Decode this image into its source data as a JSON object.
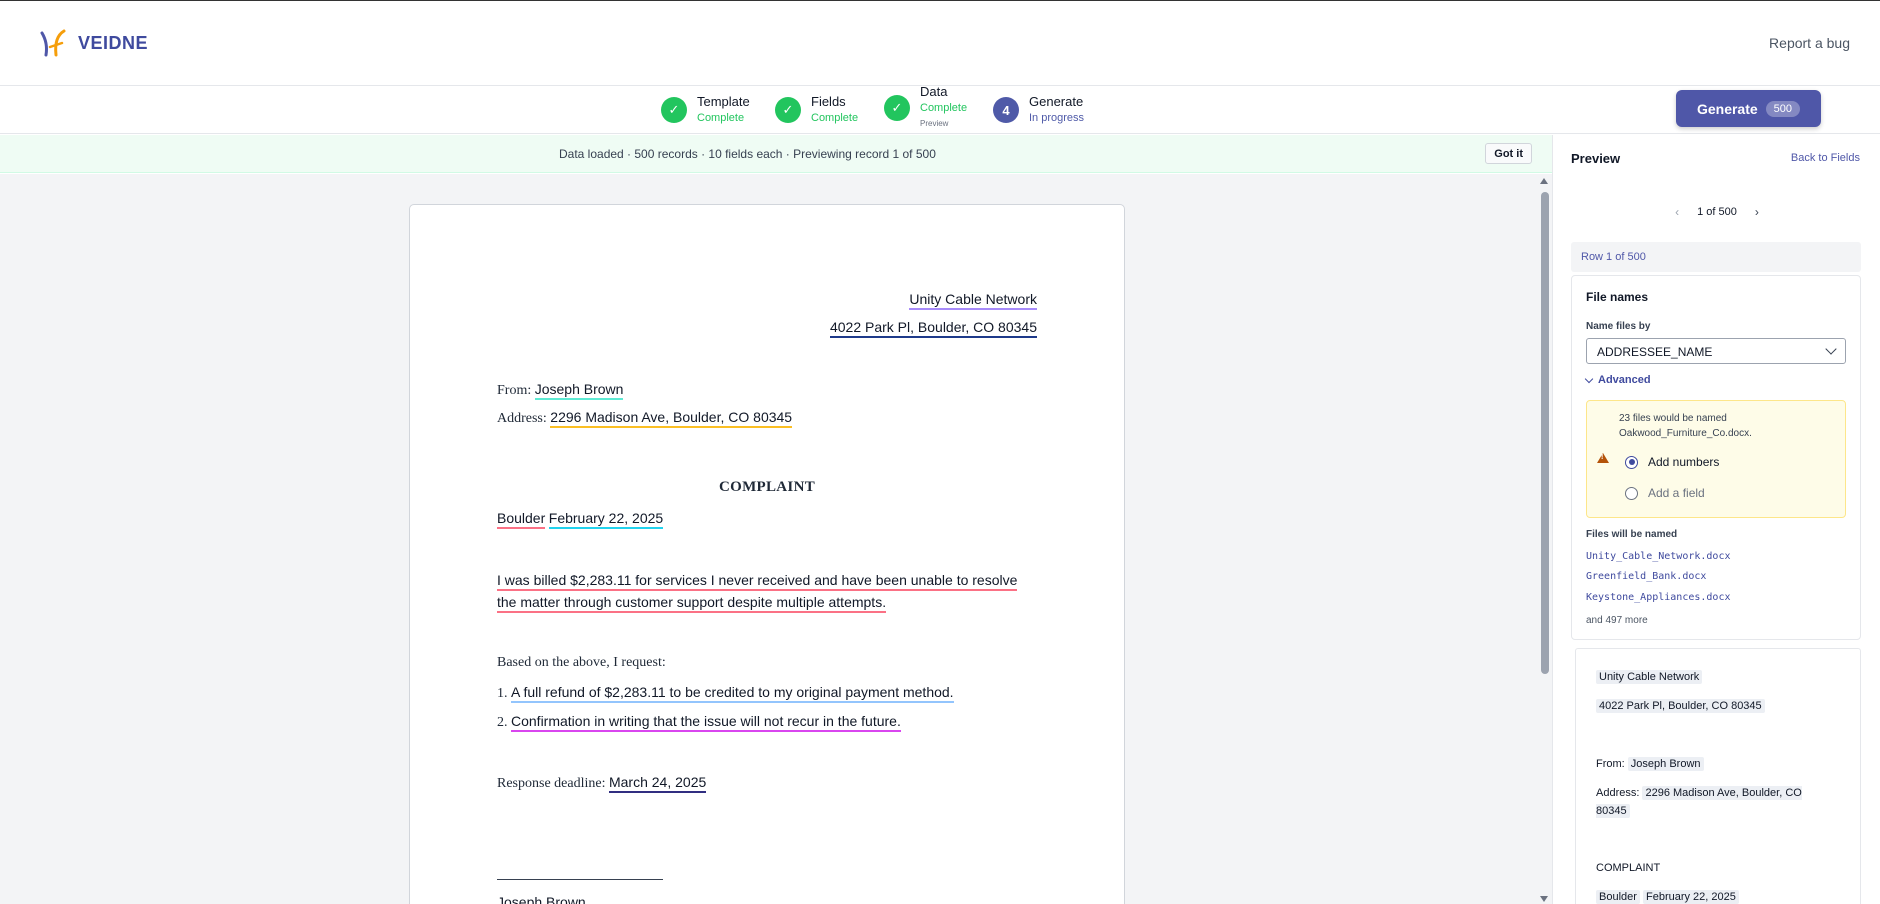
{
  "app": {
    "brand": "VEIDNE",
    "report_bug": "Report a bug"
  },
  "steps": [
    {
      "label": "Template",
      "status": "Complete",
      "state": "done"
    },
    {
      "label": "Fields",
      "status": "Complete",
      "state": "done"
    },
    {
      "label": "Data",
      "status": "Complete",
      "sub": "Preview",
      "state": "done"
    },
    {
      "label": "Generate",
      "status": "In progress",
      "number": "4",
      "state": "active"
    }
  ],
  "generate": {
    "label": "Generate",
    "count": "500"
  },
  "banner": {
    "text": "Data loaded · 500 records · 10 fields each · Previewing record 1 of 500",
    "dismiss": "Got it"
  },
  "document": {
    "addressee_name": "Unity Cable Network",
    "addressee_address": "4022 Park Pl, Boulder, CO 80345",
    "from_label": "From:",
    "from_name": "Joseph Brown",
    "address_label": "Address:",
    "sender_address": "2296 Madison Ave, Boulder, CO 80345",
    "title": "COMPLAINT",
    "city": "Boulder",
    "date": "February 22, 2025",
    "complaint_line1": "I was billed $2,283.11 for services I never received and have been unable to resolve",
    "complaint_line2": "the matter through customer support despite multiple attempts.",
    "request_intro": "Based on the above, I request:",
    "request1_num": "1.",
    "request1": "A full refund of $2,283.11 to be credited to my original payment method.",
    "request2_num": "2.",
    "request2": "Confirmation in writing that the issue will not recur in the future.",
    "deadline_label": "Response deadline:",
    "deadline": "March 24, 2025",
    "signature": "Joseph Brown"
  },
  "preview_panel": {
    "title": "Preview",
    "back": "Back to Fields",
    "pager": "1 of 500",
    "row": "Row 1 of 500",
    "file_names": {
      "title": "File names",
      "name_by_label": "Name files by",
      "name_by_value": "ADDRESSEE_NAME",
      "advanced": "Advanced",
      "warning": "23 files would be named Oakwood_Furniture_Co.docx.",
      "option_numbers": "Add numbers",
      "option_field": "Add a field",
      "selected": "Add numbers",
      "will_be_label": "Files will be named",
      "examples": [
        "Unity_Cable_Network.docx",
        "Greenfield_Bank.docx",
        "Keystone_Appliances.docx"
      ],
      "more": "and 497 more"
    },
    "mini_doc": {
      "addressee_name": "Unity Cable Network",
      "addressee_address": "4022 Park Pl, Boulder, CO 80345",
      "from_label": "From:",
      "from_name": "Joseph Brown",
      "address_label": "Address:",
      "sender_address": "2296 Madison Ave, Boulder, CO 80345",
      "title": "COMPLAINT",
      "city": "Boulder",
      "date": "February 22, 2025"
    }
  },
  "colors": {
    "accent": "#4f57a8",
    "success": "#22c55e",
    "banner_bg": "#effcf4",
    "warning_bg": "#fefce8"
  }
}
